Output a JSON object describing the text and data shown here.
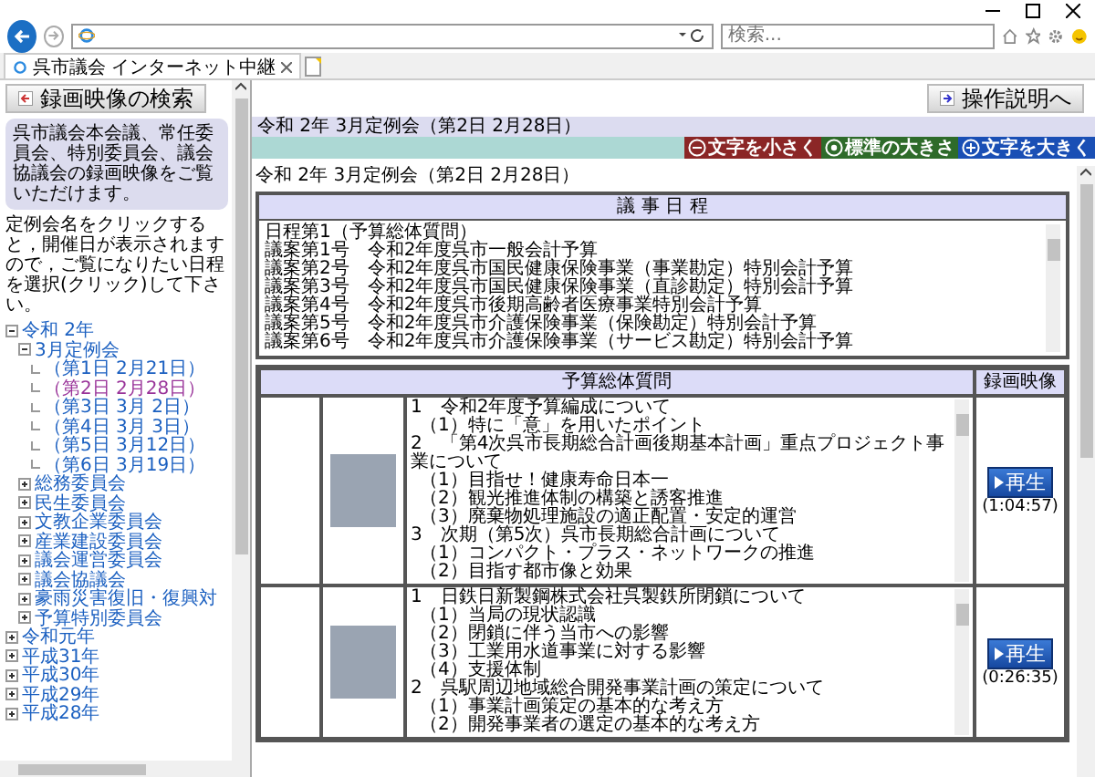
{
  "browser": {
    "search_placeholder": "検索...",
    "tab_title": "呉市議会 インターネット中継"
  },
  "sidebar": {
    "search_button": "録画映像の検索",
    "intro": "呉市議会本会議、常任委員会、特別委員会、議会協議会の録画映像をご覧いただけます。",
    "instructions": "定例会名をクリックすると，開催日が表示されますので，ご覧になりたい日程を選択(クリック)して下さい。",
    "tree": [
      {
        "label": "令和 2年",
        "expanded": true,
        "children": [
          {
            "label": "3月定例会",
            "expanded": true,
            "children": [
              {
                "label": "（第1日 2月21日）",
                "selected": false
              },
              {
                "label": "（第2日 2月28日）",
                "selected": true
              },
              {
                "label": "（第3日 3月 2日）",
                "selected": false
              },
              {
                "label": "（第4日 3月 3日）",
                "selected": false
              },
              {
                "label": "（第5日 3月12日）",
                "selected": false
              },
              {
                "label": "（第6日 3月19日）",
                "selected": false
              }
            ]
          },
          {
            "label": "総務委員会",
            "expanded": false
          },
          {
            "label": "民生委員会",
            "expanded": false
          },
          {
            "label": "文教企業委員会",
            "expanded": false
          },
          {
            "label": "産業建設委員会",
            "expanded": false
          },
          {
            "label": "議会運営委員会",
            "expanded": false
          },
          {
            "label": "議会協議会",
            "expanded": false
          },
          {
            "label": "豪雨災害復旧・復興対",
            "expanded": false
          },
          {
            "label": "予算特別委員会",
            "expanded": false
          }
        ]
      },
      {
        "label": "令和元年",
        "expanded": false
      },
      {
        "label": "平成31年",
        "expanded": false
      },
      {
        "label": "平成30年",
        "expanded": false
      },
      {
        "label": "平成29年",
        "expanded": false
      },
      {
        "label": "平成28年",
        "expanded": false
      }
    ]
  },
  "main": {
    "help_button": "操作説明へ",
    "breadcrumb": "令和 2年 3月定例会（第2日 2月28日）",
    "size_buttons": [
      {
        "kind": "smaller",
        "label": "文字を小さく"
      },
      {
        "kind": "normal",
        "label": "標準の大きさ"
      },
      {
        "kind": "larger",
        "label": "文字を大きく"
      }
    ],
    "heading": "令和 2年 3月定例会（第2日 2月28日）",
    "agenda": {
      "header": "議 事 日 程",
      "lines": [
        "日程第1（予算総体質問）",
        "議案第1号　令和2年度呉市一般会計予算",
        "議案第2号　令和2年度呉市国民健康保険事業（事業勘定）特別会計予算",
        "議案第3号　令和2年度呉市国民健康保険事業（直診勘定）特別会計予算",
        "議案第4号　令和2年度呉市後期高齢者医療事業特別会計予算",
        "議案第5号　令和2年度呉市介護保険事業（保険勘定）特別会計予算",
        "議案第6号　令和2年度呉市介護保険事業（サービス勘定）特別会計予算"
      ]
    },
    "table": {
      "columns": [
        "予算総体質問",
        "録画映像"
      ],
      "rows": [
        {
          "lines": [
            {
              "kind": "topic",
              "text": "1　令和2年度予算編成について"
            },
            {
              "kind": "sub",
              "text": "（1）特に「意」を用いたポイント"
            },
            {
              "kind": "topic",
              "text": "2　「第4次呉市長期総合計画後期基本計画」重点プロジェクト事業について"
            },
            {
              "kind": "sub",
              "text": "（1）目指せ！健康寿命日本一"
            },
            {
              "kind": "sub",
              "text": "（2）観光推進体制の構築と誘客推進"
            },
            {
              "kind": "sub",
              "text": "（3）廃棄物処理施設の適正配置・安定的運営"
            },
            {
              "kind": "topic",
              "text": "3　次期（第5次）呉市長期総合計画について"
            },
            {
              "kind": "sub",
              "text": "（1）コンパクト・プラス・ネットワークの推進"
            },
            {
              "kind": "sub",
              "text": "（2）目指す都市像と効果"
            }
          ],
          "play": "再生",
          "duration": "(1:04:57)"
        },
        {
          "lines": [
            {
              "kind": "topic",
              "text": "1　日鉄日新製鋼株式会社呉製鉄所閉鎖について"
            },
            {
              "kind": "sub",
              "text": "（1）当局の現状認識"
            },
            {
              "kind": "sub",
              "text": "（2）閉鎖に伴う当市への影響"
            },
            {
              "kind": "sub",
              "text": "（3）工業用水道事業に対する影響"
            },
            {
              "kind": "sub",
              "text": "（4）支援体制"
            },
            {
              "kind": "topic",
              "text": "2　呉駅周辺地域総合開発事業計画の策定について"
            },
            {
              "kind": "sub",
              "text": "（1）事業計画策定の基本的な考え方"
            },
            {
              "kind": "sub",
              "text": "（2）開発事業者の選定の基本的な考え方"
            }
          ],
          "play": "再生",
          "duration": "(0:26:35)"
        }
      ]
    }
  }
}
